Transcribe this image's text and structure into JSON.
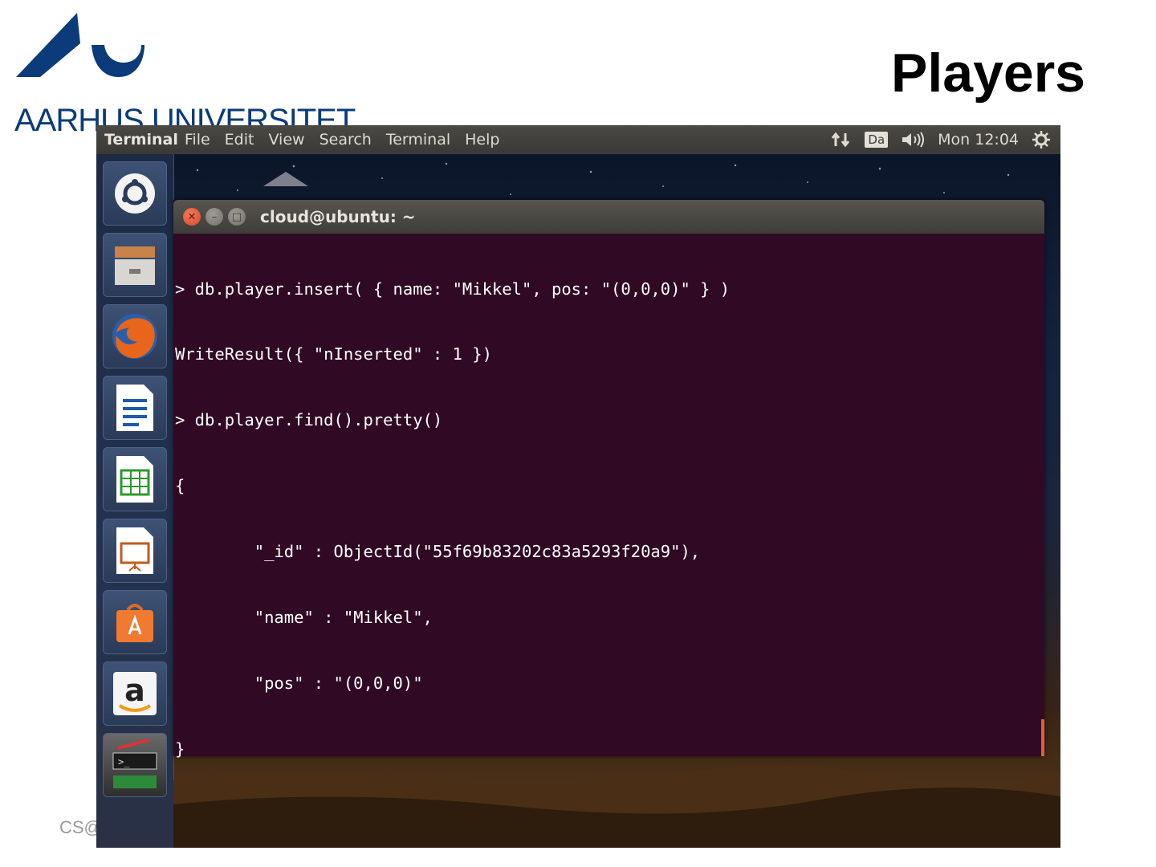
{
  "slide": {
    "title": "Players",
    "logo_text": "AARHUS UNIVERSITET",
    "footer": "CS@"
  },
  "topbar": {
    "app_name": "Terminal",
    "menus": [
      "File",
      "Edit",
      "View",
      "Search",
      "Terminal",
      "Help"
    ],
    "keyboard_layout": "Da",
    "clock": "Mon 12:04",
    "icons": [
      "network-icon",
      "keyboard-layout-indicator",
      "volume-icon",
      "gear-icon"
    ]
  },
  "launcher": {
    "items": [
      "dash-icon",
      "files-icon",
      "firefox-icon",
      "writer-icon",
      "calc-icon",
      "impress-icon",
      "software-center-icon",
      "amazon-icon",
      "stacked-apps-icon"
    ]
  },
  "terminal": {
    "title": "cloud@ubuntu: ~",
    "lines": [
      "> db.player.insert( { name: \"Mikkel\", pos: \"(0,0,0)\" } )",
      "WriteResult({ \"nInserted\" : 1 })",
      "> db.player.find().pretty()",
      "{",
      "        \"_id\" : ObjectId(\"55f69b83202c83a5293f20a9\"),",
      "        \"name\" : \"Mikkel\",",
      "        \"pos\" : \"(0,0,0)\"",
      "}",
      ">"
    ]
  },
  "colors": {
    "terminal_bg": "#300a24",
    "brand_blue": "#0b3b7a",
    "accent_orange": "#e25f3a"
  }
}
